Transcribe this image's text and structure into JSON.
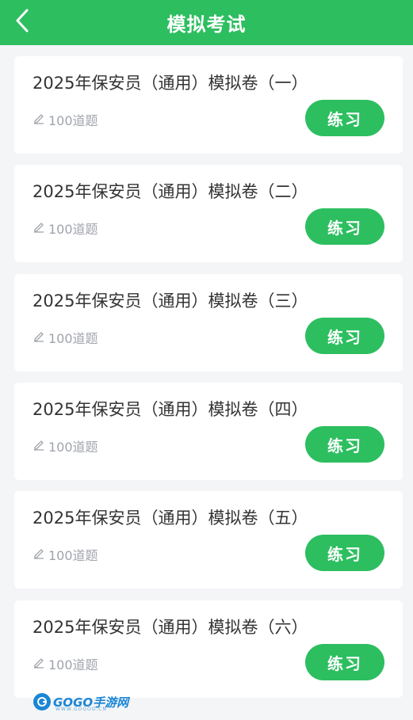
{
  "header": {
    "title": "模拟考试",
    "back_icon": "chevron-left-icon"
  },
  "practice": {
    "items": [
      {
        "title": "2025年保安员（通用）模拟卷（一）",
        "count": "100道题",
        "button": "练习"
      },
      {
        "title": "2025年保安员（通用）模拟卷（二）",
        "count": "100道题",
        "button": "练习"
      },
      {
        "title": "2025年保安员（通用）模拟卷（三）",
        "count": "100道题",
        "button": "练习"
      },
      {
        "title": "2025年保安员（通用）模拟卷（四）",
        "count": "100道题",
        "button": "练习"
      },
      {
        "title": "2025年保安员（通用）模拟卷（五）",
        "count": "100道题",
        "button": "练习"
      },
      {
        "title": "2025年保安员（通用）模拟卷（六）",
        "count": "100道题",
        "button": "练习"
      }
    ]
  },
  "watermark": {
    "brand": "GOGO手游网",
    "url": "WWW.GOGOO.CN"
  },
  "colors": {
    "accent": "#2dbe60",
    "background": "#f4f5f7",
    "meta_text": "#a0a4ab"
  }
}
